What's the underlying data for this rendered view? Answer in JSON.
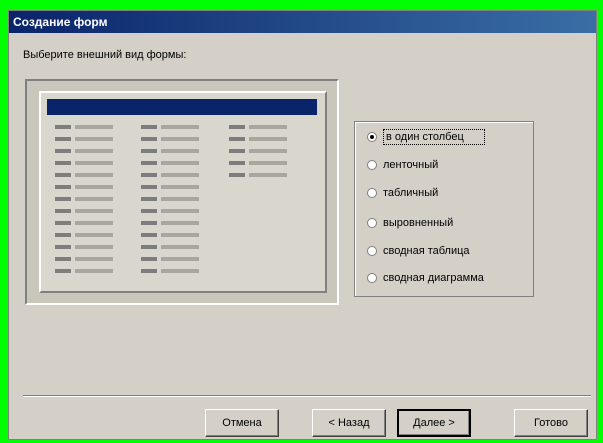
{
  "window": {
    "title": "Создание форм"
  },
  "prompt": "Выберите внешний вид формы:",
  "options": [
    {
      "label": "в один столбец",
      "selected": true
    },
    {
      "label": "ленточный",
      "selected": false
    },
    {
      "label": "табличный",
      "selected": false
    },
    {
      "label": "выровненный",
      "selected": false
    },
    {
      "label": "сводная таблица",
      "selected": false
    },
    {
      "label": "сводная диаграмма",
      "selected": false
    }
  ],
  "buttons": {
    "cancel": "Отмена",
    "back": "< Назад",
    "next": "Далее >",
    "finish": "Готово"
  }
}
